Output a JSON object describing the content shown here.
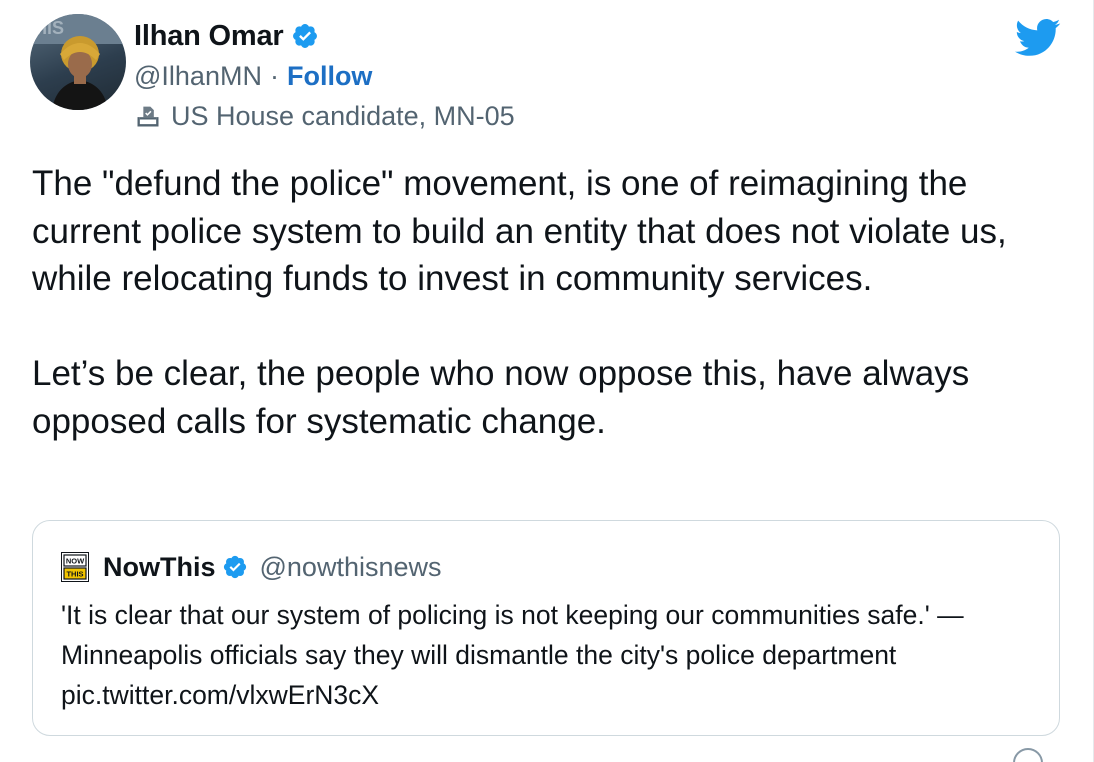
{
  "author": {
    "name": "Ilhan Omar",
    "handle": "@IlhanMN",
    "separator": "·",
    "follow_label": "Follow",
    "label": "US House candidate, MN-05",
    "avatar_icon": "person-avatar",
    "verified_icon": "verified-badge-icon"
  },
  "tweet": {
    "paragraph1": "The \"defund the police\" movement, is one of reimagining the current police system to build an entity that does not violate us, while relocating funds to invest in community services.",
    "paragraph2": "Let’s be clear, the people who now oppose this, have always opposed calls for systematic change."
  },
  "quoted_tweet": {
    "name": "NowThis",
    "handle": "@nowthisnews",
    "logo_text_top": "NOW",
    "logo_text_bottom": "THIS",
    "text": "'It is clear that our system of policing is not keeping our communities safe.' — Minneapolis officials say they will dismantle the city's police department pic.twitter.com/vlxwErN3cX"
  },
  "colors": {
    "text": "#0f1419",
    "secondary": "#536471",
    "link": "#1d6fc4",
    "twitter_blue": "#1d9bf0",
    "verified": "#1d9bf0",
    "border": "#cfd9de"
  },
  "icons": {
    "logo": "twitter-bird-icon",
    "label": "ballot-box-icon"
  }
}
